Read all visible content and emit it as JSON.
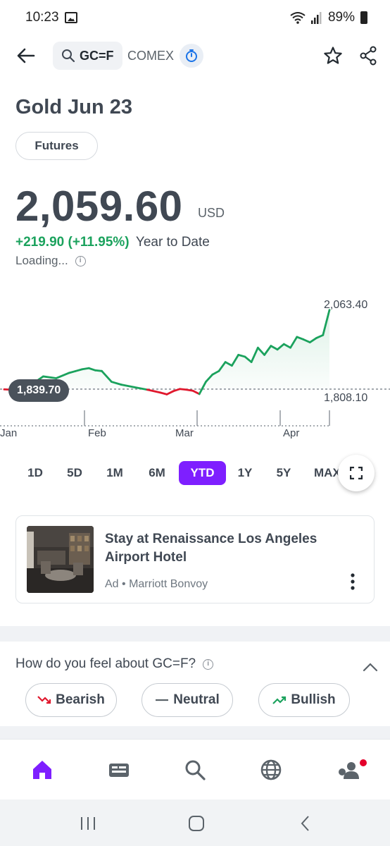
{
  "status_bar": {
    "time": "10:23",
    "battery": "89%"
  },
  "header": {
    "symbol": "GC=F",
    "exchange": "COMEX"
  },
  "quote": {
    "name": "Gold Jun 23",
    "type_chip": "Futures",
    "price": "2,059.60",
    "currency": "USD",
    "change": "+219.90 (+11.95%)",
    "period": "Year to Date",
    "status": "Loading..."
  },
  "colors": {
    "accent": "#7e1fff",
    "up": "#1ba25d",
    "down": "#e0182d",
    "text": "#404853"
  },
  "chart_data": {
    "type": "line",
    "title": "",
    "x_ticks": [
      "Jan",
      "Feb",
      "Mar",
      "Apr"
    ],
    "high_label": "2,063.40",
    "low_label": "1,808.10",
    "previous_close_label": "1,839.70",
    "baseline": 1839.7,
    "ylim": [
      1808.1,
      2063.4
    ],
    "x": [
      0,
      4,
      8,
      12,
      16,
      20,
      22,
      24,
      26,
      28,
      30,
      33,
      36,
      40,
      44,
      48,
      50,
      52,
      54,
      56,
      58,
      60,
      62,
      64,
      66,
      68,
      70,
      72,
      74,
      76,
      78,
      80,
      82,
      84,
      86,
      88,
      90,
      92,
      94,
      96,
      98,
      100
    ],
    "y": [
      1839,
      1837,
      1850,
      1875,
      1870,
      1885,
      1890,
      1895,
      1898,
      1892,
      1890,
      1860,
      1852,
      1845,
      1838,
      1830,
      1825,
      1834,
      1840,
      1838,
      1835,
      1826,
      1860,
      1880,
      1890,
      1915,
      1905,
      1935,
      1930,
      1915,
      1955,
      1935,
      1960,
      1950,
      1965,
      1955,
      1985,
      1978,
      1970,
      1982,
      1990,
      2060
    ]
  },
  "ranges": [
    "1D",
    "5D",
    "1M",
    "6M",
    "YTD",
    "1Y",
    "5Y",
    "MAX"
  ],
  "active_range": "YTD",
  "ad": {
    "title": "Stay at Renaissance Los Angeles Airport Hotel",
    "label": "Ad",
    "sponsor": "Marriott Bonvoy"
  },
  "sentiment": {
    "question": "How do you feel about GC=F?",
    "bearish": "Bearish",
    "neutral": "Neutral",
    "bullish": "Bullish"
  },
  "bottom_nav": [
    "home-icon",
    "news-icon",
    "search-icon",
    "globe-icon",
    "community-icon"
  ]
}
